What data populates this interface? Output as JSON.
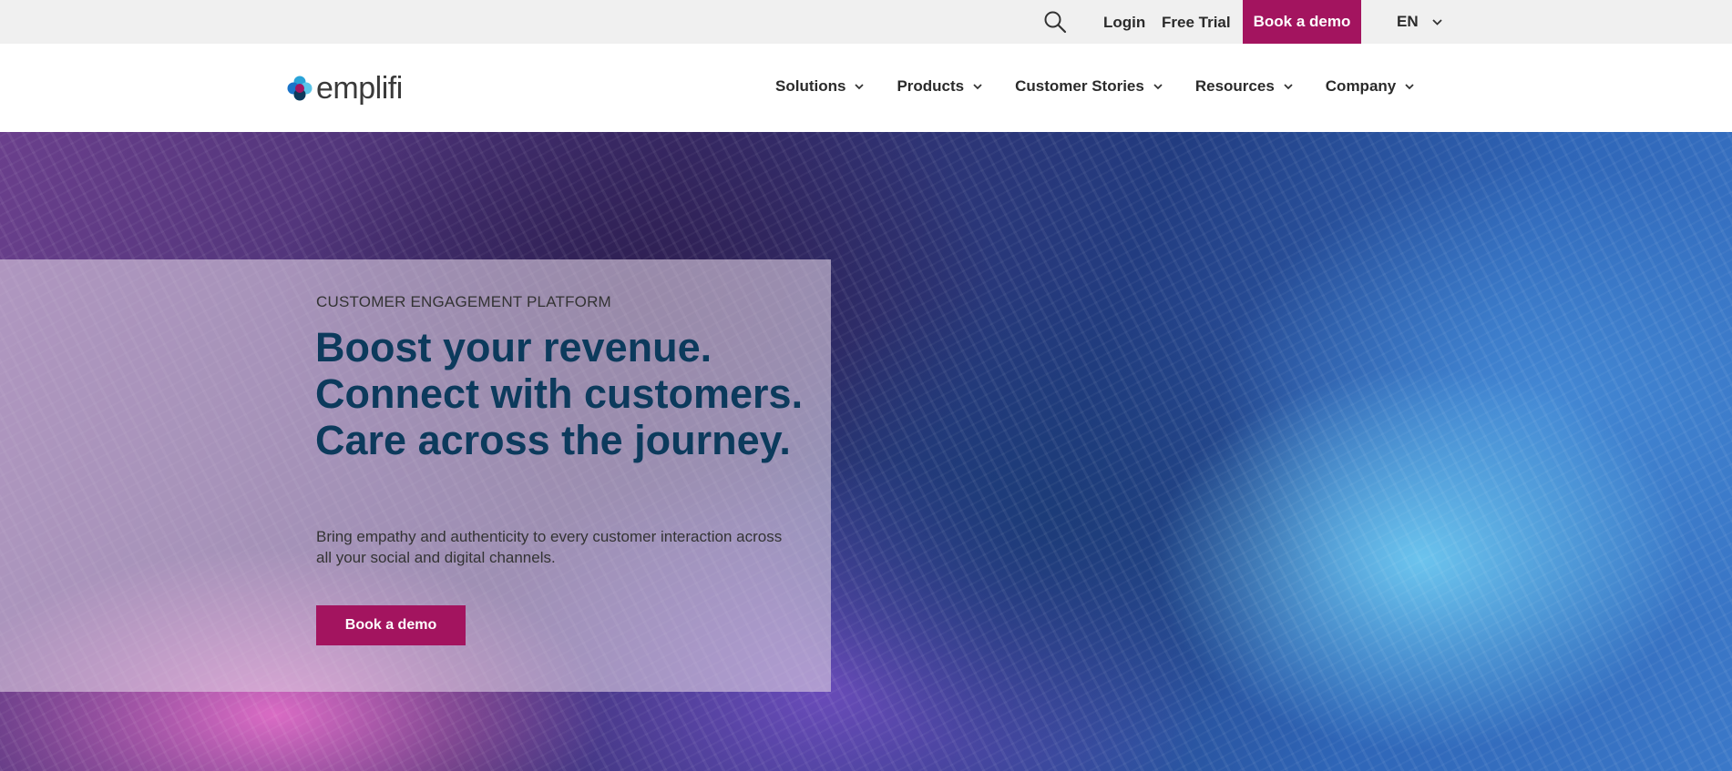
{
  "utility_bar": {
    "search_icon": "search-icon",
    "login_label": "Login",
    "free_trial_label": "Free Trial",
    "book_demo_label": "Book a demo",
    "language_label": "EN",
    "language_icon": "chevron-down-icon"
  },
  "main_nav": {
    "logo_text": "emplifi",
    "items": [
      {
        "label": "Solutions"
      },
      {
        "label": "Products"
      },
      {
        "label": "Customer Stories"
      },
      {
        "label": "Resources"
      },
      {
        "label": "Company"
      }
    ]
  },
  "hero": {
    "eyebrow": "CUSTOMER ENGAGEMENT PLATFORM",
    "headline": "Boost your revenue. Connect with customers. Care across the journey.",
    "subtext": "Bring empathy and authenticity to every customer interaction across all your social and digital channels.",
    "cta_label": "Book a demo"
  },
  "colors": {
    "accent": "#a3145f",
    "headline": "#0c3a5c",
    "utility_bg": "#f0f0f0"
  }
}
